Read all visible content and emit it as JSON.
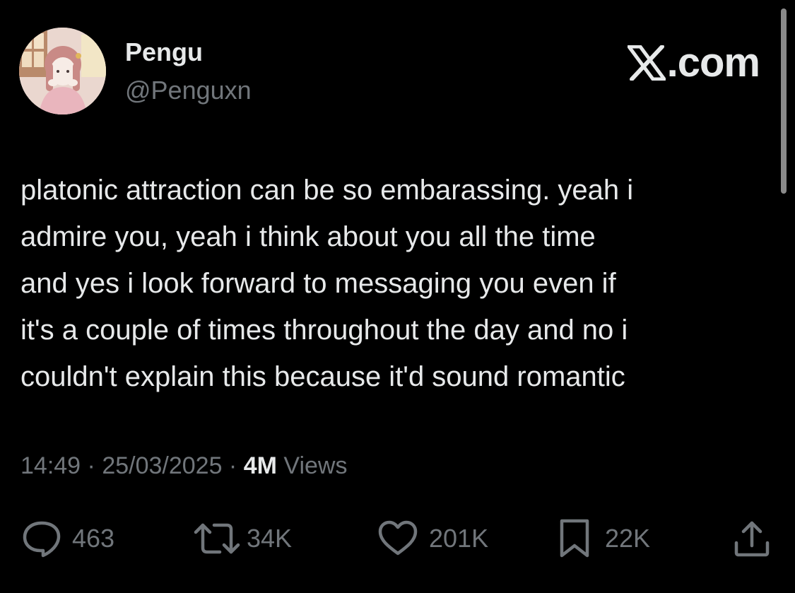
{
  "author": {
    "display_name": "Pengu",
    "handle": "@Penguxn"
  },
  "brand": {
    "name": "X.com",
    "suffix": ".com"
  },
  "tweet": {
    "text": "platonic attraction can be so embarassing. yeah i\nadmire you, yeah i think about you all the time\nand yes i look forward to messaging you even if\nit's a couple of times throughout the day and no i\ncouldn't explain this because it'd sound romantic"
  },
  "meta": {
    "time": "14:49",
    "separator": " · ",
    "date": "25/03/2025",
    "views_count": "4M",
    "views_label": " Views"
  },
  "actions": {
    "replies": "463",
    "reposts": "34K",
    "likes": "201K",
    "bookmarks": "22K"
  },
  "icons": [
    "reply-icon",
    "repost-icon",
    "like-icon",
    "bookmark-icon",
    "share-icon"
  ],
  "colors": {
    "background": "#000000",
    "primary_text": "#e7e9ea",
    "secondary_text": "#71767b"
  }
}
